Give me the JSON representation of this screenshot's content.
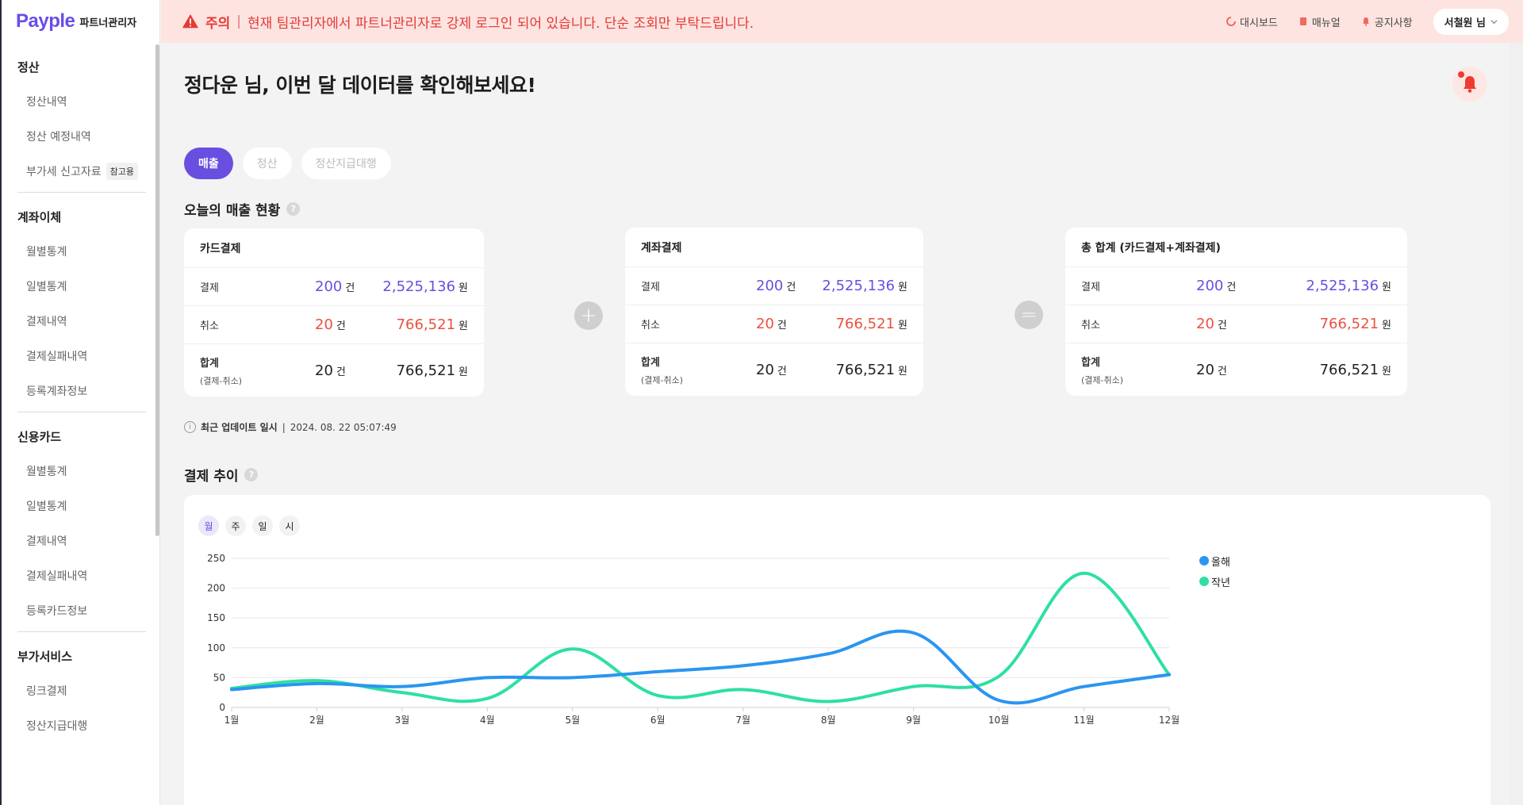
{
  "brand": {
    "name": "Payple",
    "subtitle": "파트너관리자"
  },
  "banner": {
    "label": "주의",
    "separator": "|",
    "message": "현재 팀관리자에서 파트너관리자로 강제 로그인 되어 있습니다. 단순 조회만 부탁드립니다."
  },
  "topnav": {
    "dashboard": "대시보드",
    "manual": "매뉴얼",
    "notice": "공지사항",
    "user": "서철원 님"
  },
  "sidebar": {
    "groups": [
      {
        "title": "정산",
        "items": [
          "정산내역",
          "정산 예정내역",
          "부가세 신고자료"
        ],
        "badge": "참고용"
      },
      {
        "title": "계좌이체",
        "items": [
          "월별통계",
          "일별통계",
          "결제내역",
          "결제실패내역",
          "등록계좌정보"
        ]
      },
      {
        "title": "신용카드",
        "items": [
          "월별통계",
          "일별통계",
          "결제내역",
          "결제실패내역",
          "등록카드정보"
        ]
      },
      {
        "title": "부가서비스",
        "items": [
          "링크결제",
          "정산지급대행"
        ]
      }
    ]
  },
  "greeting": "정다운 님, 이번 달 데이터를 확인해보세요!",
  "tabs": [
    "매출",
    "정산",
    "정산지급대행"
  ],
  "today": {
    "title": "오늘의 매출 현황",
    "cards": [
      {
        "title": "카드결제",
        "rows": [
          {
            "label": "결제",
            "count": "200",
            "amount": "2,525,136"
          },
          {
            "label": "취소",
            "count": "20",
            "amount": "766,521"
          },
          {
            "label": "합계",
            "sublabel": "(결제-취소)",
            "count": "20",
            "amount": "766,521"
          }
        ]
      },
      {
        "title": "계좌결제",
        "rows": [
          {
            "label": "결제",
            "count": "200",
            "amount": "2,525,136"
          },
          {
            "label": "취소",
            "count": "20",
            "amount": "766,521"
          },
          {
            "label": "합계",
            "sublabel": "(결제-취소)",
            "count": "20",
            "amount": "766,521"
          }
        ]
      },
      {
        "title": "총 합계 (카드결제+계좌결제)",
        "rows": [
          {
            "label": "결제",
            "count": "200",
            "amount": "2,525,136"
          },
          {
            "label": "취소",
            "count": "20",
            "amount": "766,521"
          },
          {
            "label": "합계",
            "sublabel": "(결제-취소)",
            "count": "20",
            "amount": "766,521"
          }
        ]
      }
    ],
    "count_unit": "건",
    "amount_unit": "원",
    "op_plus": "+",
    "op_equals": "="
  },
  "update": {
    "label": "최근 업데이트 일시",
    "separator": "|",
    "datetime": "2024. 08. 22 05:07:49"
  },
  "trend": {
    "title": "결제 추이",
    "periods": [
      "월",
      "주",
      "일",
      "시"
    ]
  },
  "colors": {
    "accent": "#6a4ee0",
    "this_year": "#2b95f0",
    "last_year": "#2ee0a0",
    "cancel": "#e9523f"
  },
  "chart_data": {
    "type": "line",
    "categories": [
      "1월",
      "2월",
      "3월",
      "4월",
      "5월",
      "6월",
      "7월",
      "8월",
      "9월",
      "10월",
      "11월",
      "12월"
    ],
    "series": [
      {
        "name": "올해",
        "values": [
          30,
          40,
          35,
          50,
          50,
          60,
          70,
          90,
          125,
          12,
          35,
          55
        ]
      },
      {
        "name": "작년",
        "values": [
          32,
          45,
          25,
          15,
          98,
          20,
          30,
          10,
          35,
          52,
          225,
          55
        ]
      }
    ],
    "yticks": [
      0,
      50,
      100,
      150,
      200,
      250
    ],
    "ylim": [
      0,
      250
    ],
    "grid": true,
    "legend": "top-right"
  }
}
